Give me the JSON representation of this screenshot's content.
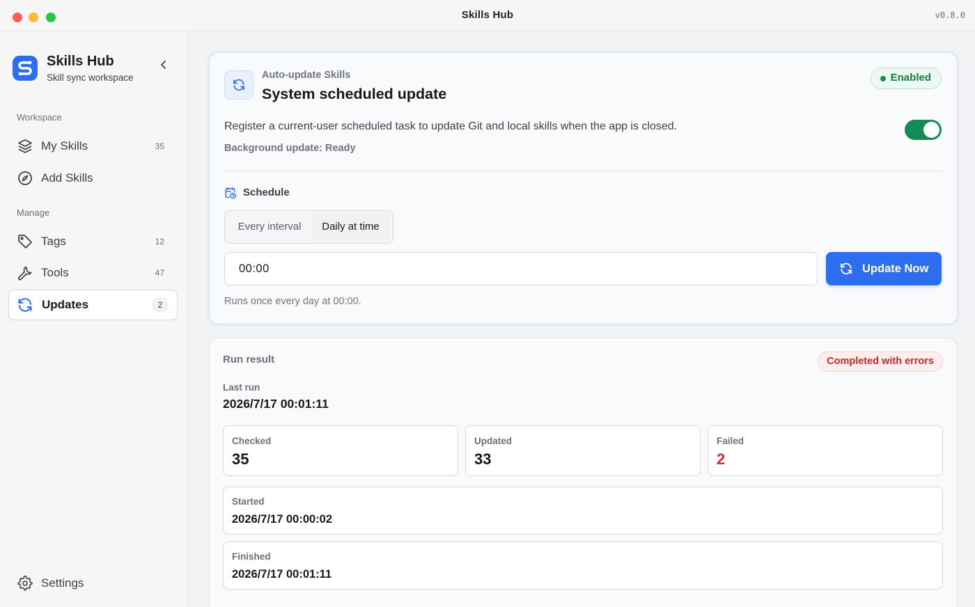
{
  "window": {
    "title": "Skills Hub",
    "version": "v0.8.0"
  },
  "sidebar": {
    "brand_name": "Skills Hub",
    "brand_subtitle": "Skill sync workspace",
    "sections": {
      "workspace": "Workspace",
      "manage": "Manage"
    },
    "items": [
      {
        "label": "My Skills",
        "count": "35",
        "icon": "layers-icon"
      },
      {
        "label": "Add Skills",
        "count": "",
        "icon": "compass-icon"
      },
      {
        "label": "Tags",
        "count": "12",
        "icon": "tag-icon"
      },
      {
        "label": "Tools",
        "count": "47",
        "icon": "wrench-icon"
      },
      {
        "label": "Updates",
        "count": "2",
        "icon": "refresh-icon",
        "active": true
      }
    ],
    "settings_label": "Settings"
  },
  "auto_update": {
    "eyebrow": "Auto-update Skills",
    "title": "System scheduled update",
    "status": "Enabled",
    "description": "Register a current-user scheduled task to update Git and local skills when the app is closed.",
    "background_status": "Background update: Ready",
    "toggle_on": true,
    "schedule_label": "Schedule",
    "modes": [
      "Every interval",
      "Daily at time"
    ],
    "selected_mode": "Daily at time",
    "time_value": "00:00",
    "update_button": "Update Now",
    "note": "Runs once every day at 00:00."
  },
  "run_result": {
    "title": "Run result",
    "status": "Completed with errors",
    "last_run_label": "Last run",
    "last_run": "2026/7/17 00:01:11",
    "stats": [
      {
        "label": "Checked",
        "value": "35"
      },
      {
        "label": "Updated",
        "value": "33"
      },
      {
        "label": "Failed",
        "value": "2"
      }
    ],
    "started_label": "Started",
    "started": "2026/7/17 00:00:02",
    "finished_label": "Finished",
    "finished": "2026/7/17 00:01:11"
  },
  "colors": {
    "accent": "#2d6ef0",
    "enabled_green": "#157a45",
    "toggle_green": "#168a55",
    "error_red": "#c62b2b"
  }
}
